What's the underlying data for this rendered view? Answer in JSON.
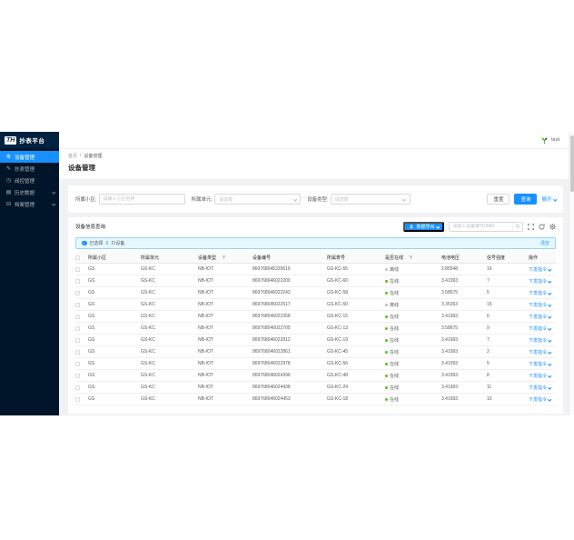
{
  "sidebar": {
    "logo_badge": "TH",
    "logo_text": "抄表平台",
    "items": [
      {
        "label": "设备管理",
        "icon": "gear-icon",
        "glyph": "⚙",
        "active": true,
        "arrow": false
      },
      {
        "label": "抄表管理",
        "icon": "edit-icon",
        "glyph": "✎",
        "active": false,
        "arrow": false
      },
      {
        "label": "阀控管理",
        "icon": "clock-icon",
        "glyph": "◷",
        "active": false,
        "arrow": false
      },
      {
        "label": "历史数据",
        "icon": "chart-icon",
        "glyph": "▤",
        "active": false,
        "arrow": true
      },
      {
        "label": "档案管理",
        "icon": "folder-icon",
        "glyph": "⊟",
        "active": false,
        "arrow": true
      }
    ]
  },
  "topbar": {
    "username": "test"
  },
  "breadcrumb": {
    "home": "首页",
    "separator": "/",
    "current": "设备管理"
  },
  "page_title": "设备管理",
  "filters": {
    "community_label": "所属小区:",
    "community_placeholder": "请输入小区名称",
    "unit_label": "所属单元:",
    "unit_placeholder": "请选择",
    "type_label": "设备类型:",
    "type_placeholder": "请选择",
    "reset_label": "重置",
    "search_label": "查询",
    "expand_label": "展开"
  },
  "toolbar": {
    "section_title": "设备信息查询",
    "export_label": "数据导出",
    "search_placeholder": "请输入设备编号/IMEI"
  },
  "selection_bar": {
    "selected_prefix": "已选择",
    "selected_count": "0",
    "selected_suffix": "只设备",
    "clear_label": "清空"
  },
  "table": {
    "columns": [
      {
        "label": "所属小区",
        "filter": false
      },
      {
        "label": "所属单元",
        "filter": false
      },
      {
        "label": "设备类型",
        "filter": true
      },
      {
        "label": "设备编号",
        "filter": false
      },
      {
        "label": "所属表号",
        "filter": false
      },
      {
        "label": "是否在线",
        "filter": true
      },
      {
        "label": "电池电压",
        "filter": false
      },
      {
        "label": "信号强度",
        "filter": false
      },
      {
        "label": "操作",
        "filter": false
      }
    ],
    "status_labels": {
      "online": "在线",
      "offline": "离线"
    },
    "action_label": "下发指令",
    "rows": [
      {
        "community": "GS",
        "unit": "GS-KC",
        "type": "NB-IOT",
        "device_no": "869768045335616",
        "meter_no": "GS-KC-55",
        "status": "offline",
        "voltage": "2.85548",
        "signal": "16"
      },
      {
        "community": "GS",
        "unit": "GS-KC",
        "type": "NB-IOT",
        "device_no": "869768046022200",
        "meter_no": "GS-KC-60",
        "status": "online",
        "voltage": "3.41993",
        "signal": "7"
      },
      {
        "community": "GS",
        "unit": "GS-KC",
        "type": "NB-IOT",
        "device_no": "869768046022242",
        "meter_no": "GS-KC-58",
        "status": "online",
        "voltage": "3.58675",
        "signal": "5"
      },
      {
        "community": "GS",
        "unit": "GS-KC",
        "type": "NB-IOT",
        "device_no": "869768046022517",
        "meter_no": "GS-KC-50",
        "status": "offline",
        "voltage": "3.35353",
        "signal": "15"
      },
      {
        "community": "GS",
        "unit": "GS-KC",
        "type": "NB-IOT",
        "device_no": "869768046022358",
        "meter_no": "GS-KC-15",
        "status": "online",
        "voltage": "3.41993",
        "signal": "6"
      },
      {
        "community": "GS",
        "unit": "GS-KC",
        "type": "NB-IOT",
        "device_no": "869768046022705",
        "meter_no": "GS-KC-13",
        "status": "online",
        "voltage": "3.58675",
        "signal": "9"
      },
      {
        "community": "GS",
        "unit": "GS-KC",
        "type": "NB-IOT",
        "device_no": "869768046022812",
        "meter_no": "GS-KC-19",
        "status": "online",
        "voltage": "3.41993",
        "signal": "7"
      },
      {
        "community": "GS",
        "unit": "GS-KC",
        "type": "NB-IOT",
        "device_no": "869768046022861",
        "meter_no": "GS-KC-45",
        "status": "online",
        "voltage": "3.41993",
        "signal": "2"
      },
      {
        "community": "GS",
        "unit": "GS-KC",
        "type": "NB-IOT",
        "device_no": "869768046022978",
        "meter_no": "GS-KC-56",
        "status": "online",
        "voltage": "3.41993",
        "signal": "5"
      },
      {
        "community": "GS",
        "unit": "GS-KC",
        "type": "NB-IOT",
        "device_no": "869768046024396",
        "meter_no": "GS-KC-48",
        "status": "online",
        "voltage": "3.41993",
        "signal": "8"
      },
      {
        "community": "GS",
        "unit": "GS-KC",
        "type": "NB-IOT",
        "device_no": "869768046024438",
        "meter_no": "GS-KC-24",
        "status": "online",
        "voltage": "3.41993",
        "signal": "11"
      },
      {
        "community": "GS",
        "unit": "GS-KC",
        "type": "NB-IOT",
        "device_no": "869768046024453",
        "meter_no": "GS-KC-18",
        "status": "online",
        "voltage": "3.41993",
        "signal": "10"
      }
    ]
  },
  "colors": {
    "accent": "#1890ff",
    "sidebar_bg": "#001529",
    "sidebar_logo_bg": "#002140",
    "online": "#52c41a",
    "offline": "#bfbfbf",
    "info_bar_bg": "#e6f7ff",
    "info_bar_border": "#91d5ff",
    "main_bg": "#f0f2f5"
  }
}
